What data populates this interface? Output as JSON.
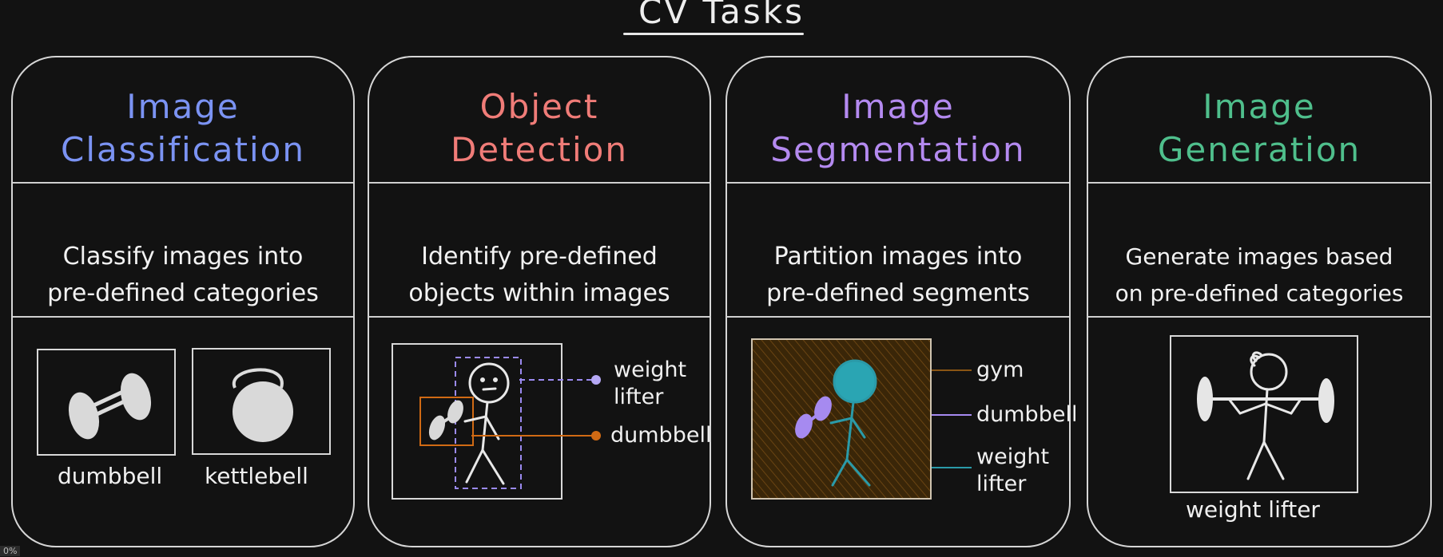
{
  "title": "CV Tasks",
  "cards": [
    {
      "title_line1": "Image",
      "title_line2": "Classification",
      "color": "#7b93f3",
      "desc_line1": "Classify images into",
      "desc_line2": "pre-defined categories",
      "captions": [
        "dumbbell",
        "kettlebell"
      ]
    },
    {
      "title_line1": "Object",
      "title_line2": "Detection",
      "color": "#f07c78",
      "desc_line1": "Identify pre-defined",
      "desc_line2": "objects within images",
      "labels": {
        "person_line1": "weight",
        "person_line2": "lifter",
        "dumbbell": "dumbbell"
      }
    },
    {
      "title_line1": "Image",
      "title_line2": "Segmentation",
      "color": "#b48af0",
      "desc_line1": "Partition images into",
      "desc_line2": "pre-defined segments",
      "labels": {
        "gym": "gym",
        "dumbbell": "dumbbell",
        "person_line1": "weight",
        "person_line2": "lifter"
      }
    },
    {
      "title_line1": "Image",
      "title_line2": "Generation",
      "color": "#4fbf8c",
      "desc_line1": "Generate images based",
      "desc_line2": "on pre-defined categories",
      "caption": "weight lifter"
    }
  ],
  "colors": {
    "detection_person": "#9b8af0",
    "detection_dumbbell": "#d06a14",
    "segment_gym": "#8a5514",
    "segment_dumbbell": "#a68af0",
    "segment_person": "#2a9aa8"
  },
  "corner_badge": "0%"
}
